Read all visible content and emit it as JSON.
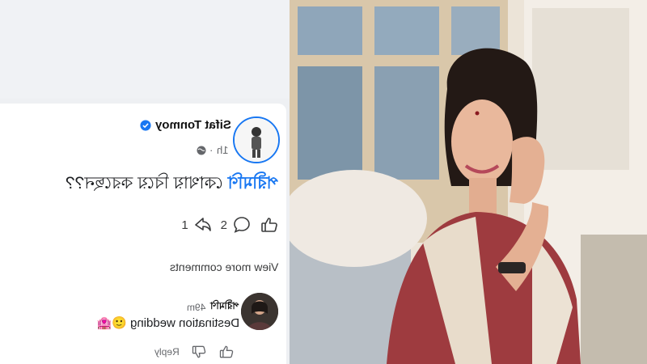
{
  "post": {
    "author": "Sifat Tonmoy",
    "time": "1h",
    "time_separator": "·",
    "text_tag": "পরীমণি",
    "text_body": "কোথায় বিয়ে করছেন??",
    "reactions": {
      "like_icon": "thumbs-up-icon",
      "comment_count": "2",
      "share_count": "1"
    }
  },
  "comments": {
    "view_more": "View more comments",
    "items": [
      {
        "author": "পরীমণি",
        "time": "49m",
        "text": "Destination wedding",
        "emoji": "🏩🙂",
        "reply_label": "Reply"
      }
    ]
  },
  "colors": {
    "accent": "#1877f2",
    "card": "#ffffff",
    "page_bg": "#f0f2f5"
  },
  "photo": {
    "subject": "woman-in-sari-photo"
  }
}
